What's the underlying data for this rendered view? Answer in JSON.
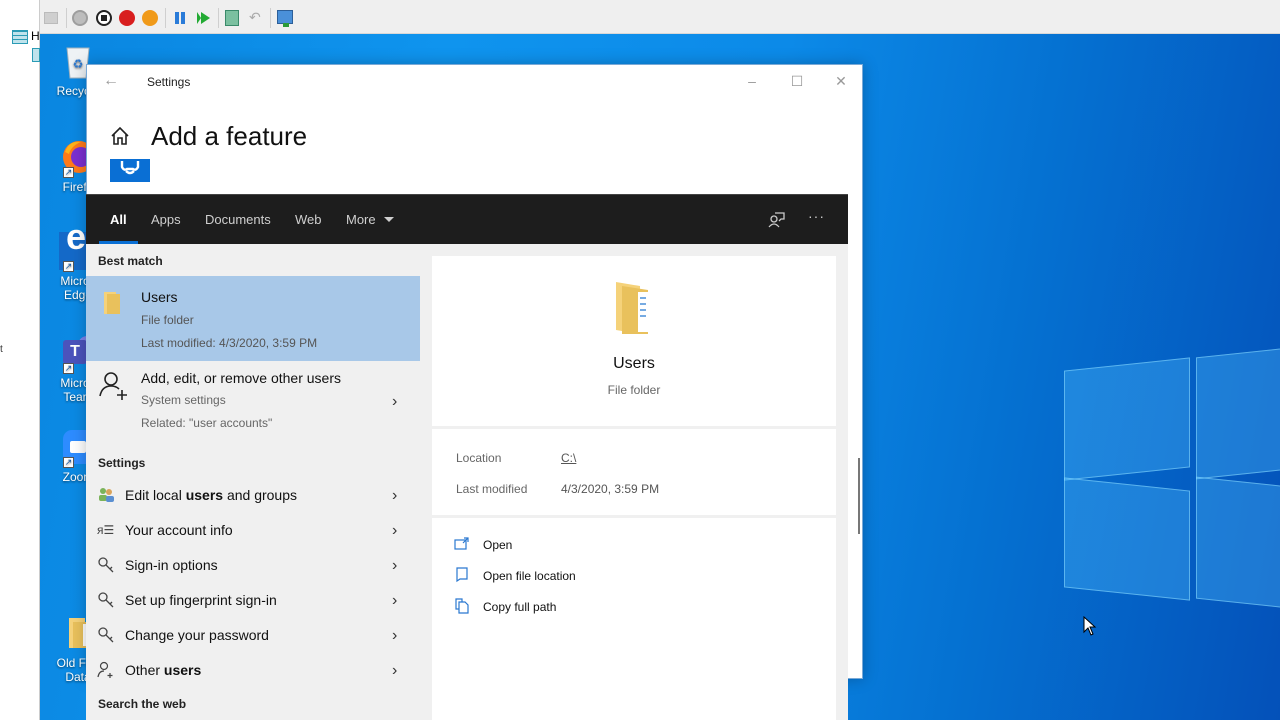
{
  "host": {
    "tree_label": "H",
    "toolbar_icons": [
      "ctrl-alt-del-icon",
      "power-gray-icon",
      "stop-icon",
      "shutdown-icon",
      "power-orange-icon",
      "pause-icon",
      "play-icon",
      "checkpoint-icon",
      "revert-icon",
      "enhanced-session-icon"
    ]
  },
  "desktop": {
    "icons": [
      {
        "label": "Recycle",
        "icon": "recycle-bin-icon"
      },
      {
        "label": "Firefo",
        "icon": "firefox-icon"
      },
      {
        "label": "Micros\nEdge",
        "icon": "edge-icon"
      },
      {
        "label": "Micros\nTeam",
        "icon": "teams-icon"
      },
      {
        "label": "Zoom",
        "icon": "zoom-icon"
      },
      {
        "label": "Old Fire\nData",
        "icon": "folder-icon"
      }
    ]
  },
  "settings": {
    "window_title": "Settings",
    "page_title": "Add a feature",
    "controls": {
      "minimize": "–",
      "maximize": "☐",
      "close": "✕"
    }
  },
  "search": {
    "tabs": [
      {
        "label": "All",
        "active": true
      },
      {
        "label": "Apps"
      },
      {
        "label": "Documents"
      },
      {
        "label": "Web"
      },
      {
        "label": "More"
      }
    ],
    "best_match_label": "Best match",
    "best_match": {
      "name": "Users",
      "type": "File folder",
      "modified": "Last modified: 4/3/2020, 3:59 PM"
    },
    "result": {
      "title": "Add, edit, or remove other users",
      "subtitle": "System settings",
      "related": "Related: \"user accounts\""
    },
    "settings_label": "Settings",
    "settings_items": [
      {
        "pre": "Edit local ",
        "bold": "users",
        "post": " and groups",
        "icon": "users-groups-icon"
      },
      {
        "pre": "Your account info",
        "bold": "",
        "post": "",
        "icon": "account-info-icon"
      },
      {
        "pre": "Sign-in options",
        "bold": "",
        "post": "",
        "icon": "key-icon"
      },
      {
        "pre": "Set up fingerprint sign-in",
        "bold": "",
        "post": "",
        "icon": "key-icon"
      },
      {
        "pre": "Change your password",
        "bold": "",
        "post": "",
        "icon": "key-icon"
      },
      {
        "pre": "Other ",
        "bold": "users",
        "post": "",
        "icon": "add-user-icon"
      }
    ],
    "web_label": "Search the web"
  },
  "preview": {
    "name": "Users",
    "type": "File folder",
    "location_label": "Location",
    "location_value": "C:\\",
    "modified_label": "Last modified",
    "modified_value": "4/3/2020, 3:59 PM",
    "actions": [
      {
        "label": "Open",
        "icon": "open-icon"
      },
      {
        "label": "Open file location",
        "icon": "file-location-icon"
      },
      {
        "label": "Copy full path",
        "icon": "copy-icon"
      }
    ]
  },
  "colors": {
    "accent": "#0a6fd4",
    "selected_row": "#a8c8e8",
    "tabs_bg": "#1d1d1d",
    "desktop_blue": "#0f94ee"
  }
}
